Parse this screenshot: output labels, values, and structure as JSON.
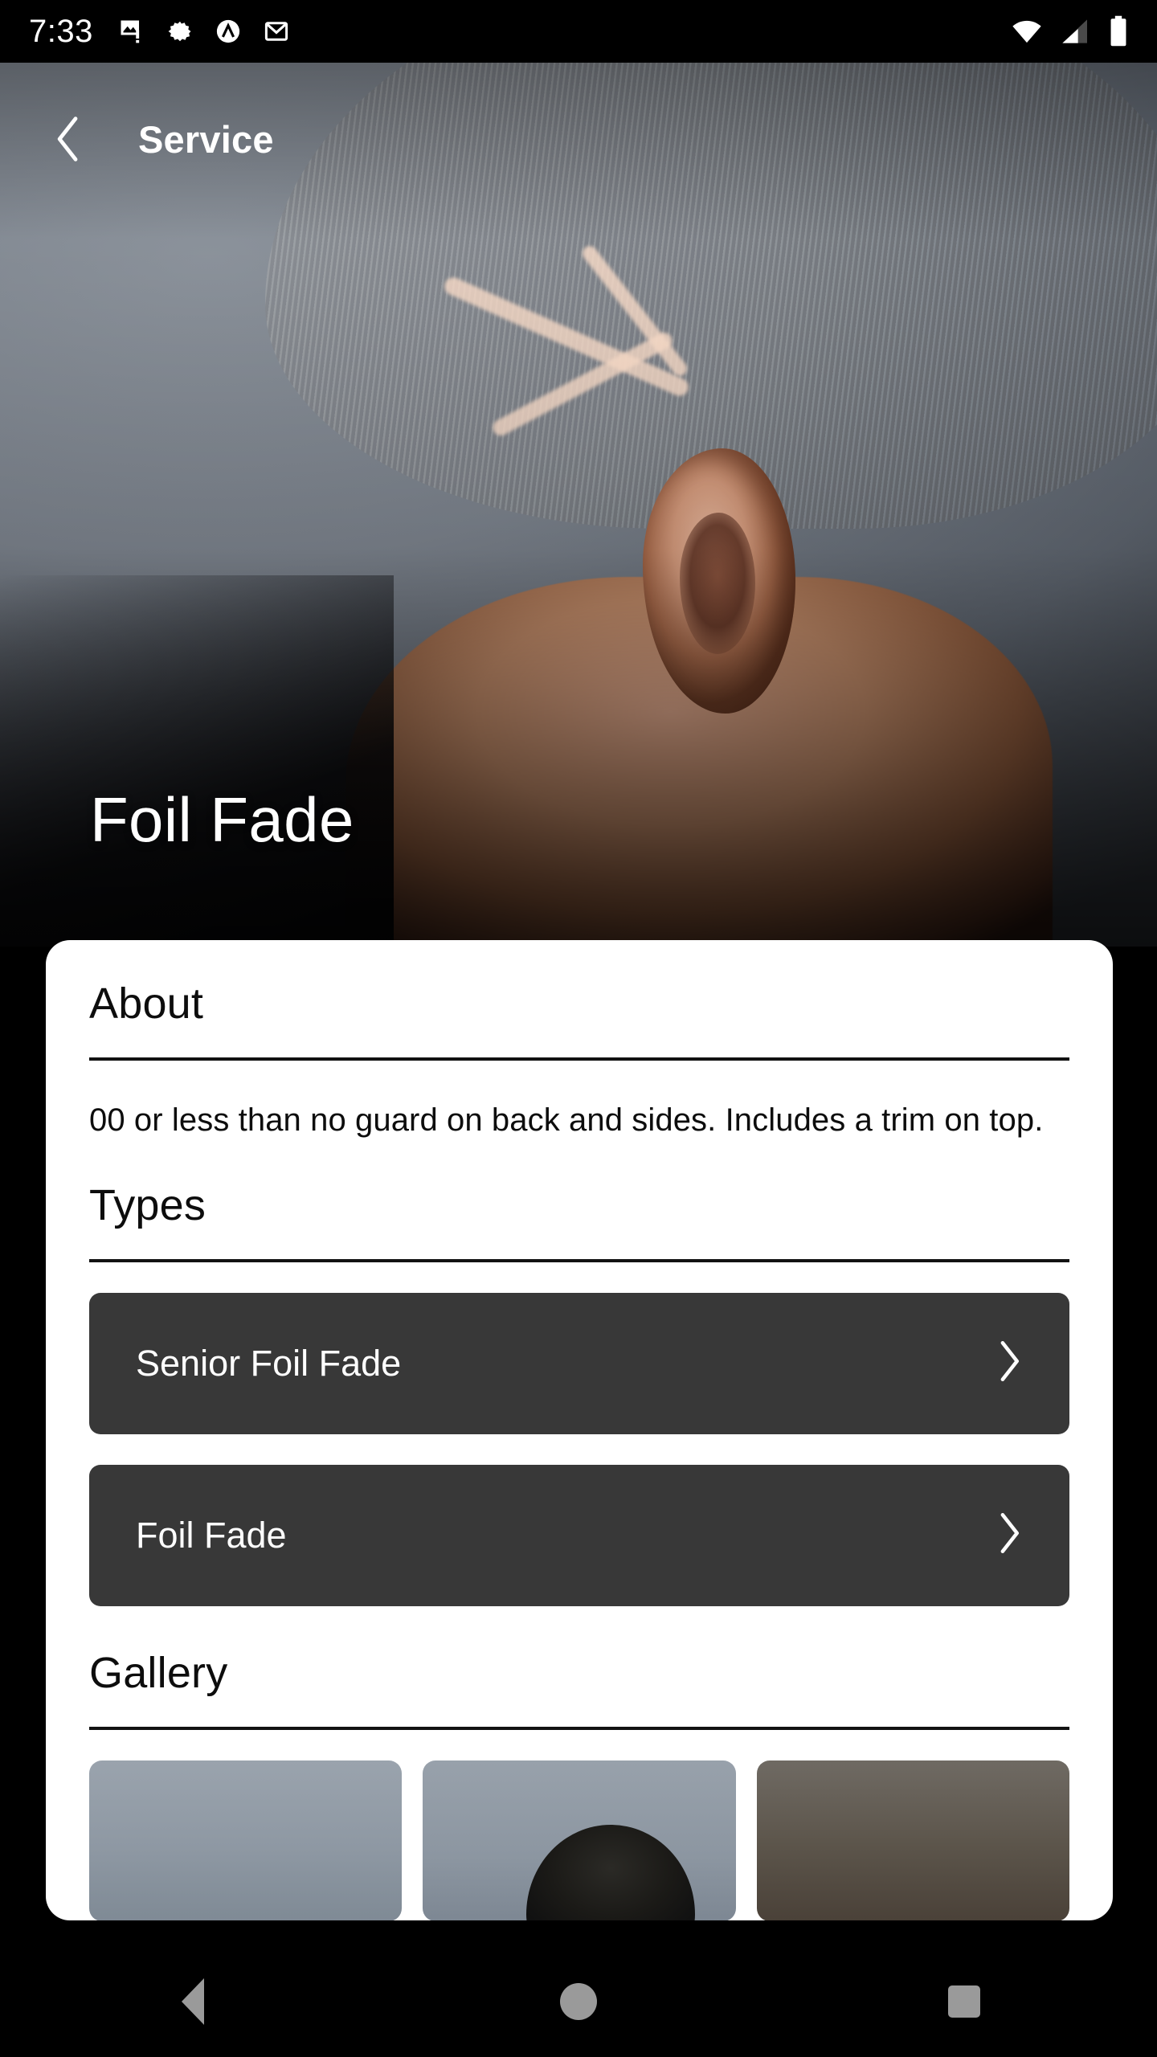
{
  "status_bar": {
    "time": "7:33",
    "left_icons": [
      "image-notification-icon",
      "settings-gear-icon",
      "android-auto-icon",
      "gmail-icon"
    ],
    "right_icons": [
      "wifi-icon",
      "cellular-signal-icon",
      "battery-icon"
    ],
    "background": "#000000",
    "foreground": "#ffffff"
  },
  "app_bar": {
    "back_label": "‹",
    "title": "Service"
  },
  "hero": {
    "title": "Foil Fade",
    "image_alt": "back-of-head-foil-fade-haircut"
  },
  "sheet": {
    "about": {
      "heading": "About",
      "text": "00 or less than no guard on back and sides. Includes a trim on top."
    },
    "types": {
      "heading": "Types",
      "items": [
        {
          "label": "Senior Foil Fade",
          "chevron": "›"
        },
        {
          "label": "Foil Fade",
          "chevron": "›"
        }
      ]
    },
    "gallery": {
      "heading": "Gallery",
      "thumbnails": [
        "blonde-spiky-hair-thumb",
        "dark-hair-thumb",
        "brown-hair-thumb"
      ]
    },
    "background": "#ffffff",
    "card_background": "#383838"
  },
  "nav_bar": {
    "items": [
      {
        "name": "back",
        "icon": "triangle-back-icon"
      },
      {
        "name": "home",
        "icon": "circle-home-icon"
      },
      {
        "name": "recents",
        "icon": "square-recents-icon"
      }
    ],
    "icon_color": "#9a9a9a"
  }
}
